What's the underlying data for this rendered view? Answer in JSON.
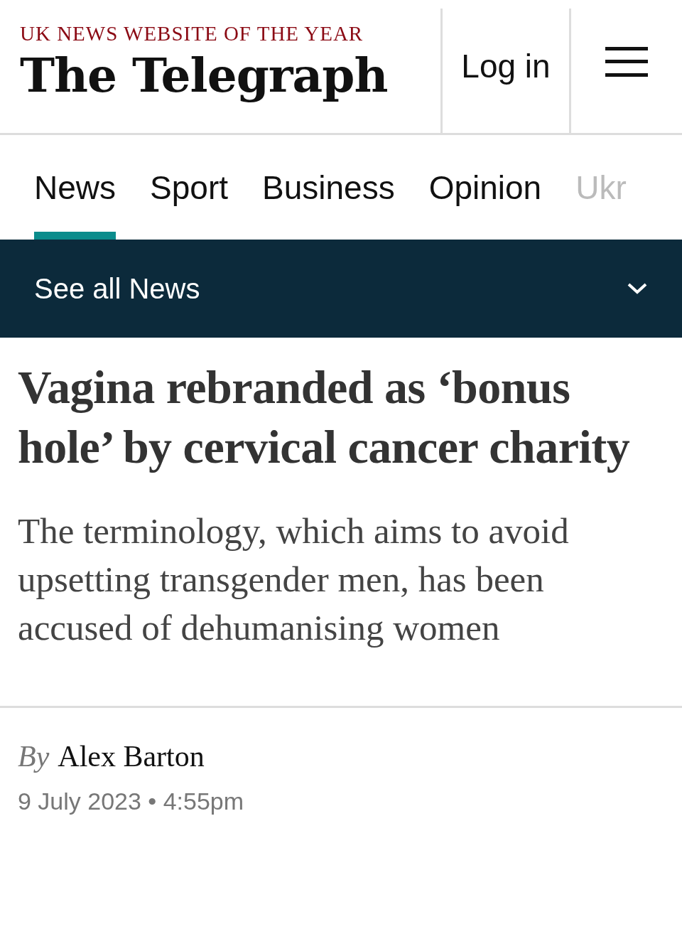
{
  "masthead": {
    "tagline": "UK NEWS WEBSITE OF THE YEAR",
    "logo": "The Telegraph",
    "login": "Log in"
  },
  "nav": {
    "tabs": [
      {
        "label": "News",
        "selected": true
      },
      {
        "label": "Sport",
        "selected": false
      },
      {
        "label": "Business",
        "selected": false
      },
      {
        "label": "Opinion",
        "selected": false
      },
      {
        "label": "Ukr",
        "selected": false
      }
    ]
  },
  "section_bar": {
    "label": "See all News",
    "expanded": false
  },
  "article": {
    "headline": "Vagina rebranded as ‘bonus hole’ by cervical cancer charity",
    "standfirst": "The terminology, which aims to avoid upsetting transgender men, has been accused of dehumanising women",
    "byline_prefix": "By",
    "author": "Alex Barton",
    "date": "9 July 2023 • 4:55pm"
  }
}
